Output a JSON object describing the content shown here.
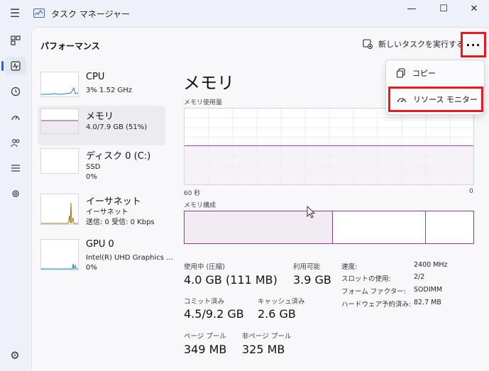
{
  "window": {
    "title": "タスク マネージャー",
    "minimize_glyph": "—",
    "maximize_glyph": "☐",
    "close_glyph": "✕"
  },
  "nav": {
    "icons": [
      "processes-icon",
      "performance-icon",
      "app-history-icon",
      "startup-apps-icon",
      "users-icon",
      "details-icon",
      "services-icon"
    ],
    "settings_icon": "gear-icon"
  },
  "header": {
    "title": "パフォーマンス",
    "new_task_label": "新しいタスクを実行する",
    "more_label": "···"
  },
  "sidebar": {
    "items": [
      {
        "title": "CPU",
        "line1": "3%  1.52 GHz",
        "line2": ""
      },
      {
        "title": "メモリ",
        "line1": "4.0/7.9 GB (51%)",
        "line2": ""
      },
      {
        "title": "ディスク 0 (C:)",
        "line1": "SSD",
        "line2": "0%"
      },
      {
        "title": "イーサネット",
        "line1": "イーサネット",
        "line2": "送信: 0  受信: 0 Kbps"
      },
      {
        "title": "GPU 0",
        "line1": "Intel(R) UHD Graphics ...",
        "line2": "0%"
      }
    ]
  },
  "main": {
    "heading": "メモリ",
    "usage_label": "メモリ使用量",
    "time_left": "60 秒",
    "time_right": "0",
    "composition_label": "メモリ構成",
    "usage_fraction": 0.51,
    "stats": {
      "in_use_label": "使用中 (圧縮)",
      "in_use_value": "4.0 GB (111 MB)",
      "available_label": "利用可能",
      "available_value": "3.9 GB",
      "committed_label": "コミット済み",
      "committed_value": "4.5/9.2 GB",
      "cached_label": "キャッシュ済み",
      "cached_value": "2.6 GB",
      "paged_label": "ページ プール",
      "paged_value": "349 MB",
      "nonpaged_label": "非ページ プール",
      "nonpaged_value": "325 MB"
    },
    "specs": {
      "speed_label": "速度:",
      "speed_value": "2400 MHz",
      "slots_label": "スロットの使用:",
      "slots_value": "2/2",
      "form_label": "フォーム ファクター:",
      "form_value": "SODIMM",
      "reserved_label": "ハードウェア予約済み:",
      "reserved_value": "82.7 MB"
    }
  },
  "menu": {
    "copy_label": "コピー",
    "resource_monitor_label": "リソース モニター"
  },
  "colors": {
    "memory_accent": "#8c3f94",
    "highlight_red": "#e8181e",
    "cpu_accent": "#1f7fc1",
    "ethernet_accent": "#a0791f"
  }
}
